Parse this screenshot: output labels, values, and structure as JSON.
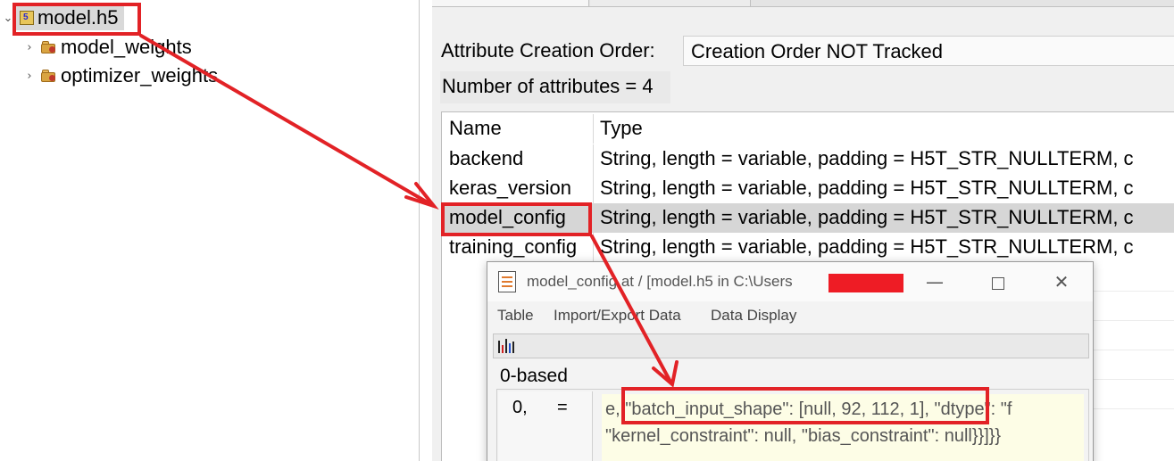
{
  "tree": {
    "root": {
      "label": "model.h5",
      "icon": "hdf5-file-icon"
    },
    "children": [
      {
        "label": "model_weights",
        "icon": "group-folder-icon"
      },
      {
        "label": "optimizer_weights",
        "icon": "group-folder-icon"
      }
    ]
  },
  "attributes": {
    "creation_order_label": "Attribute Creation Order:",
    "creation_order_value": "Creation Order NOT Tracked",
    "count_text": "Number of attributes = 4",
    "table": {
      "columns": [
        "Name",
        "Type"
      ],
      "rows": [
        {
          "name": "backend",
          "type": "String, length = variable, padding = H5T_STR_NULLTERM, c"
        },
        {
          "name": "keras_version",
          "type": "String, length = variable, padding = H5T_STR_NULLTERM, c"
        },
        {
          "name": "model_config",
          "type": "String, length = variable, padding = H5T_STR_NULLTERM, c"
        },
        {
          "name": "training_config",
          "type": "String, length = variable, padding = H5T_STR_NULLTERM, c"
        }
      ],
      "selected_row": "model_config"
    }
  },
  "dialog": {
    "title": "model_config  at  /  [model.h5  in  C:\\Users",
    "menu": [
      "Table",
      "Import/Export Data",
      "Data Display"
    ],
    "index_base": "0-based",
    "row_index": "0,",
    "row_eq": "=",
    "cell_lines": [
      "e, \"batch_input_shape\": [null, 92, 112, 1], \"dtype\": \"f",
      "\"kernel_constraint\": null, \"bias_constraint\": null}}]}}"
    ],
    "controls": {
      "minimize": "—",
      "close": "✕"
    }
  },
  "colors": {
    "annotation": "#e22226",
    "selected_row": "#d6d6d6",
    "cell_bg": "#fdfde6"
  }
}
